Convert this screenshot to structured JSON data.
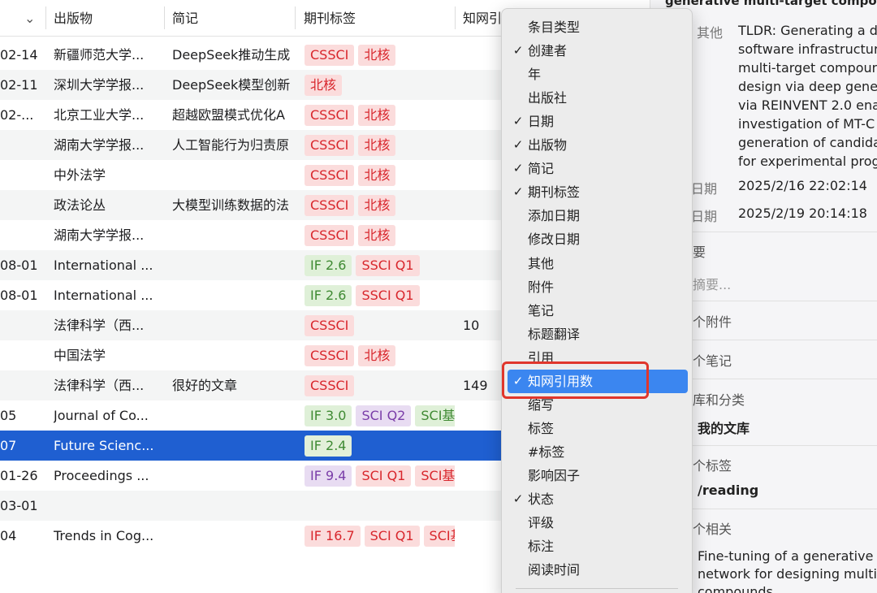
{
  "table": {
    "headers": {
      "sort_indicator": "⌄",
      "publication": "出版物",
      "note": "简记",
      "journal_tags": "期刊标签",
      "cnki_cites": "知网引"
    },
    "rows": [
      {
        "date": "02-14",
        "pub": "新疆师范大学...",
        "note": "DeepSeek推动生成",
        "tags": [
          {
            "t": "CSSCI",
            "c": "red"
          },
          {
            "t": "北核",
            "c": "red"
          }
        ],
        "cite": ""
      },
      {
        "date": "02-11",
        "pub": "深圳大学学报...",
        "note": "DeepSeek模型创新",
        "tags": [
          {
            "t": "北核",
            "c": "red"
          }
        ],
        "cite": ""
      },
      {
        "date": "02-...",
        "pub": "北京工业大学...",
        "note": "超越欧盟模式优化A",
        "tags": [
          {
            "t": "CSSCI",
            "c": "red"
          },
          {
            "t": "北核",
            "c": "red"
          }
        ],
        "cite": ""
      },
      {
        "date": "",
        "pub": "湖南大学学报...",
        "note": "人工智能行为归责原",
        "tags": [
          {
            "t": "CSSCI",
            "c": "red"
          },
          {
            "t": "北核",
            "c": "red"
          }
        ],
        "cite": ""
      },
      {
        "date": "",
        "pub": "中外法学",
        "note": "",
        "tags": [
          {
            "t": "CSSCI",
            "c": "red"
          },
          {
            "t": "北核",
            "c": "red"
          }
        ],
        "cite": ""
      },
      {
        "date": "",
        "pub": "政法论丛",
        "note": "大模型训练数据的法",
        "tags": [
          {
            "t": "CSSCI",
            "c": "red"
          },
          {
            "t": "北核",
            "c": "red"
          }
        ],
        "cite": ""
      },
      {
        "date": "",
        "pub": "湖南大学学报...",
        "note": "",
        "tags": [
          {
            "t": "CSSCI",
            "c": "red"
          },
          {
            "t": "北核",
            "c": "red"
          }
        ],
        "cite": ""
      },
      {
        "date": "08-01",
        "pub": "International ...",
        "note": "",
        "tags": [
          {
            "t": "IF 2.6",
            "c": "green"
          },
          {
            "t": "SSCI Q1",
            "c": "red"
          }
        ],
        "cite": ""
      },
      {
        "date": "08-01",
        "pub": "International ...",
        "note": "",
        "tags": [
          {
            "t": "IF 2.6",
            "c": "green"
          },
          {
            "t": "SSCI Q1",
            "c": "red"
          }
        ],
        "cite": ""
      },
      {
        "date": "",
        "pub": "法律科学（西...",
        "note": "",
        "tags": [
          {
            "t": "CSSCI",
            "c": "red"
          }
        ],
        "cite": "10"
      },
      {
        "date": "",
        "pub": "中国法学",
        "note": "",
        "tags": [
          {
            "t": "CSSCI",
            "c": "red"
          },
          {
            "t": "北核",
            "c": "red"
          }
        ],
        "cite": ""
      },
      {
        "date": "",
        "pub": "法律科学（西...",
        "note": "很好的文章",
        "tags": [
          {
            "t": "CSSCI",
            "c": "red"
          }
        ],
        "cite": "149"
      },
      {
        "date": "05",
        "pub": "Journal of Co...",
        "note": "",
        "tags": [
          {
            "t": "IF 3.0",
            "c": "green"
          },
          {
            "t": "SCI Q2",
            "c": "purple"
          },
          {
            "t": "SCI基",
            "c": "green"
          }
        ],
        "cite": ""
      },
      {
        "date": "07",
        "pub": "Future Scienc...",
        "note": "",
        "tags": [
          {
            "t": "IF 2.4",
            "c": "green"
          }
        ],
        "cite": "",
        "selected": true
      },
      {
        "date": "01-26",
        "pub": "Proceedings ...",
        "note": "",
        "tags": [
          {
            "t": "IF 9.4",
            "c": "purple"
          },
          {
            "t": "SCI Q1",
            "c": "red"
          },
          {
            "t": "SCI基",
            "c": "red"
          }
        ],
        "cite": ""
      },
      {
        "date": "03-01",
        "pub": "",
        "note": "",
        "tags": [],
        "cite": ""
      },
      {
        "date": "04",
        "pub": "Trends in Cog...",
        "note": "",
        "tags": [
          {
            "t": "IF 16.7",
            "c": "red"
          },
          {
            "t": "SCI Q1",
            "c": "red"
          },
          {
            "t": "SCI基",
            "c": "red"
          }
        ],
        "cite": ""
      }
    ]
  },
  "column_menu": {
    "items": [
      {
        "label": "条目类型",
        "checked": false
      },
      {
        "label": "创建者",
        "checked": true
      },
      {
        "label": "年",
        "checked": false
      },
      {
        "label": "出版社",
        "checked": false
      },
      {
        "label": "日期",
        "checked": true
      },
      {
        "label": "出版物",
        "checked": true
      },
      {
        "label": "简记",
        "checked": true
      },
      {
        "label": "期刊标签",
        "checked": true
      },
      {
        "label": "添加日期",
        "checked": false
      },
      {
        "label": "修改日期",
        "checked": false
      },
      {
        "label": "其他",
        "checked": false
      },
      {
        "label": "附件",
        "checked": false
      },
      {
        "label": "笔记",
        "checked": false
      },
      {
        "label": "标题翻译",
        "checked": false
      },
      {
        "label": "引用",
        "checked": false
      },
      {
        "label": "知网引用数",
        "checked": true,
        "active": true
      },
      {
        "label": "缩写",
        "checked": false
      },
      {
        "label": "标签",
        "checked": false
      },
      {
        "label": "#标签",
        "checked": false
      },
      {
        "label": "影响因子",
        "checked": false
      },
      {
        "label": "状态",
        "checked": true
      },
      {
        "label": "评级",
        "checked": false
      },
      {
        "label": "标注",
        "checked": false
      },
      {
        "label": "阅读时间",
        "checked": false
      }
    ],
    "check_glyph": "✓"
  },
  "item_pane": {
    "title_fragment": "generative multi-target compou",
    "extra_label": "其他",
    "extra_lines": [
      "TLDR: Generating a d",
      "software infrastructur",
      "multi-target compoun",
      "design via deep gene",
      "via REINVENT 2.0 ena",
      "investigation of MT-C",
      "generation of candida",
      "for experimental prog"
    ],
    "date_added_label": "日期",
    "date_added": "2025/2/16 22:02:14",
    "date_modified_label": "日期",
    "date_modified": "2025/2/19 20:14:18",
    "abstract_head": "要",
    "abstract_placeholder": "摘要...",
    "attachments_head": "个附件",
    "notes_head": "个笔记",
    "libraries_head": "库和分类",
    "library_name": "我的文库",
    "tags_head": "个标签",
    "tag_value": "/reading",
    "related_head": "个相关",
    "related_lines": [
      "Fine-tuning of a generative",
      "network for designing multi-",
      "compounds"
    ]
  },
  "colors": {
    "selection": "#1f5fd1",
    "menu_highlight": "#3b86f0",
    "annotation_box": "#e0362c"
  }
}
